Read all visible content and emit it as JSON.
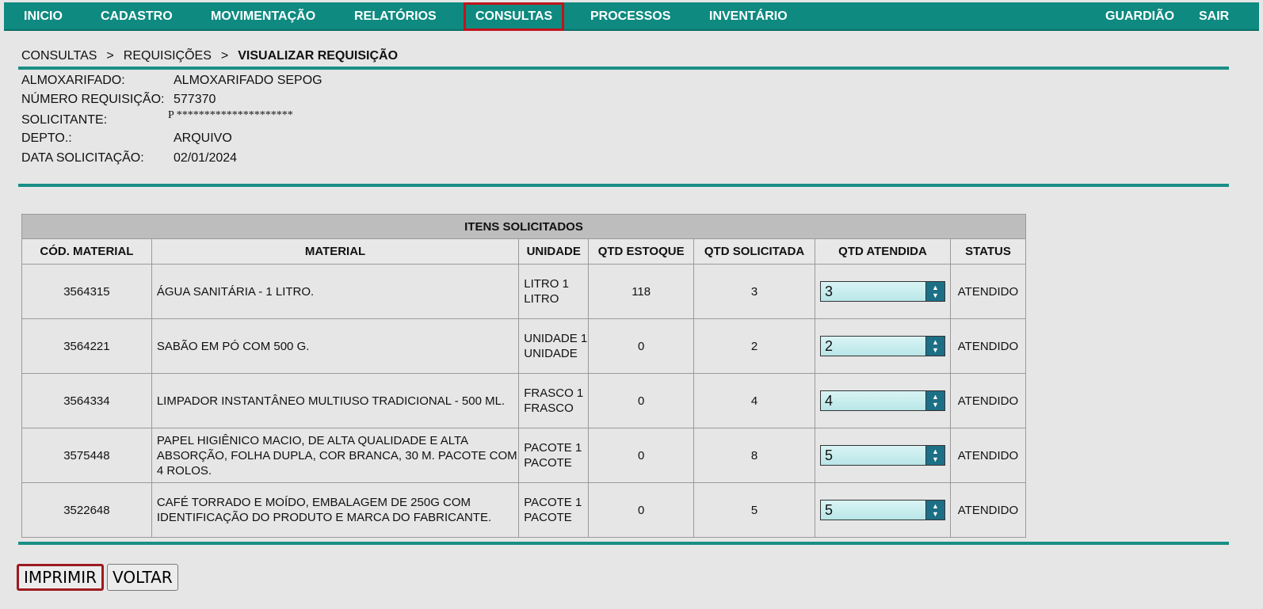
{
  "nav": {
    "items": [
      "INICIO",
      "CADASTRO",
      "MOVIMENTAÇÃO",
      "RELATÓRIOS",
      "CONSULTAS",
      "PROCESSOS",
      "INVENTÁRIO"
    ],
    "right": [
      "GUARDIÃO",
      "SAIR"
    ],
    "active": "CONSULTAS"
  },
  "breadcrumb": {
    "items": [
      "CONSULTAS",
      "REQUISIÇÕES",
      "VISUALIZAR REQUISIÇÃO"
    ],
    "separator": ">"
  },
  "info": {
    "almoxarifado_label": "ALMOXARIFADO:",
    "almoxarifado_value": "ALMOXARIFADO SEPOG",
    "numero_label": "NÚMERO REQUISIÇÃO:",
    "numero_value": "577370",
    "solicitante_label": "SOLICITANTE:",
    "solicitante_value": "P *********************",
    "depto_label": "DEPTO.:",
    "depto_value": "ARQUIVO",
    "data_label": "DATA SOLICITAÇÃO:",
    "data_value": "02/01/2024"
  },
  "table": {
    "caption": "ITENS SOLICITADOS",
    "headers": [
      "CÓD. MATERIAL",
      "MATERIAL",
      "UNIDADE",
      "QTD ESTOQUE",
      "QTD SOLICITADA",
      "QTD ATENDIDA",
      "STATUS"
    ],
    "rows": [
      {
        "cod": "3564315",
        "material": "ÁGUA SANITÁRIA - 1 LITRO.",
        "unidade": "LITRO 1 LITRO",
        "estoque": "118",
        "solicitada": "3",
        "atendida": "3",
        "status": "ATENDIDO"
      },
      {
        "cod": "3564221",
        "material": "SABÃO EM PÓ COM 500 G.",
        "unidade": "UNIDADE 1 UNIDADE",
        "estoque": "0",
        "solicitada": "2",
        "atendida": "2",
        "status": "ATENDIDO"
      },
      {
        "cod": "3564334",
        "material": "LIMPADOR INSTANTÂNEO MULTIUSO TRADICIONAL - 500 ML.",
        "unidade": "FRASCO 1 FRASCO",
        "estoque": "0",
        "solicitada": "4",
        "atendida": "4",
        "status": "ATENDIDO"
      },
      {
        "cod": "3575448",
        "material": "PAPEL HIGIÊNICO MACIO, DE ALTA QUALIDADE E ALTA ABSORÇÃO, FOLHA DUPLA, COR BRANCA, 30 M. PACOTE COM 4 ROLOS.",
        "unidade": "PACOTE 1 PACOTE",
        "estoque": "0",
        "solicitada": "8",
        "atendida": "5",
        "status": "ATENDIDO"
      },
      {
        "cod": "3522648",
        "material": "CAFÉ TORRADO E MOÍDO, EMBALAGEM DE 250G COM IDENTIFICAÇÃO DO PRODUTO E MARCA DO FABRICANTE.",
        "unidade": "PACOTE 1 PACOTE",
        "estoque": "0",
        "solicitada": "5",
        "atendida": "5",
        "status": "ATENDIDO"
      }
    ]
  },
  "buttons": {
    "print": "IMPRIMIR",
    "back": "VOLTAR"
  },
  "colors": {
    "nav_bg": "#0e8a80",
    "rule": "#1a8f86",
    "highlight": "#c0141c"
  }
}
